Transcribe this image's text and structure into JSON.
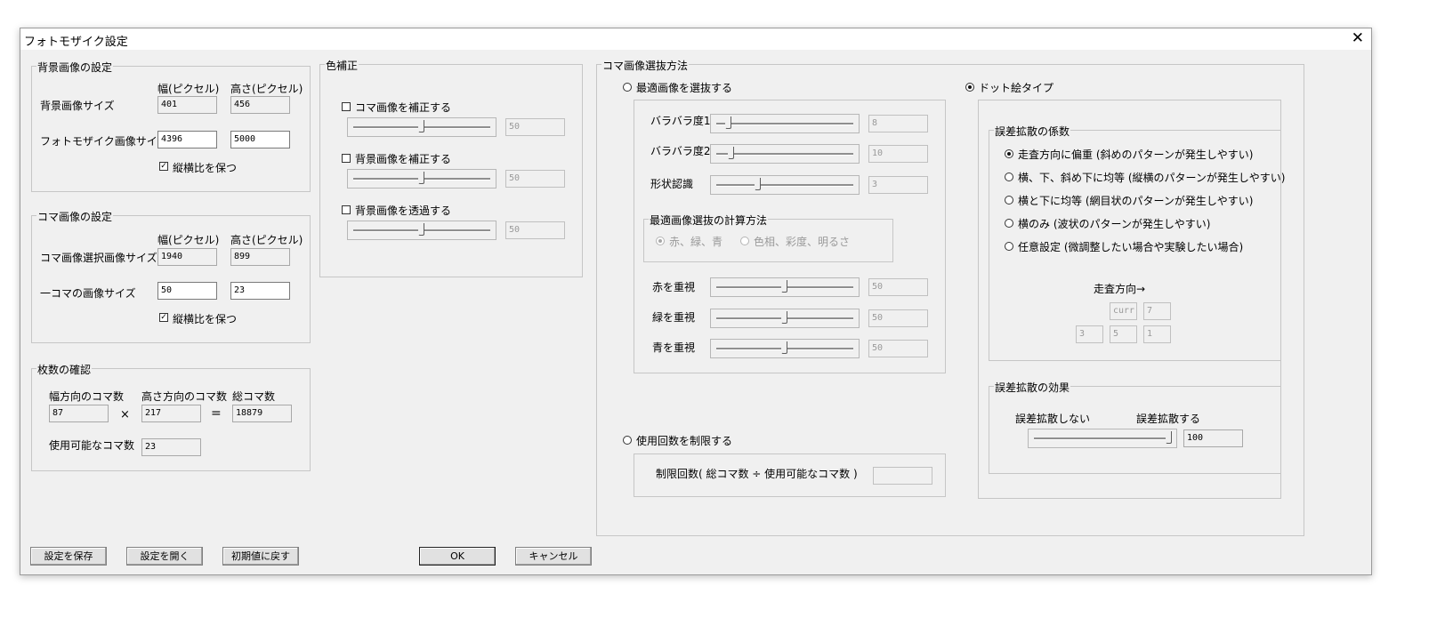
{
  "window": {
    "title": "フォトモザイク設定",
    "close_glyph": "✕"
  },
  "bg_settings": {
    "group_label": "背景画像の設定",
    "col_width": "幅(ピクセル)",
    "col_height": "高さ(ピクセル)",
    "bg_size_label": "背景画像サイズ",
    "bg_width": "401",
    "bg_height": "456",
    "mosaic_size_label": "フォトモザイク画像サイズ",
    "mosaic_width": "4396",
    "mosaic_height": "5000",
    "keep_ratio_label": "縦横比を保つ",
    "keep_ratio_checked": true
  },
  "tile_settings": {
    "group_label": "コマ画像の設定",
    "col_width": "幅(ピクセル)",
    "col_height": "高さ(ピクセル)",
    "select_size_label": "コマ画像選択画像サイズ",
    "select_width": "1940",
    "select_height": "899",
    "tile_size_label": "一コマの画像サイズ",
    "tile_width": "50",
    "tile_height": "23",
    "keep_ratio_label": "縦横比を保つ",
    "keep_ratio_checked": true
  },
  "count_check": {
    "group_label": "枚数の確認",
    "width_tiles_label": "幅方向のコマ数",
    "height_tiles_label": "高さ方向のコマ数",
    "total_tiles_label": "総コマ数",
    "width_tiles": "87",
    "times_sign": "×",
    "height_tiles": "217",
    "equals_sign": "=",
    "total_tiles": "18879",
    "usable_label": "使用可能なコマ数",
    "usable_tiles": "23"
  },
  "color_correction": {
    "group_label": "色補正",
    "items": [
      {
        "label": "コマ画像を補正する",
        "checked": false,
        "value": "50",
        "level": 0.5
      },
      {
        "label": "背景画像を補正する",
        "checked": false,
        "value": "50",
        "level": 0.5
      },
      {
        "label": "背景画像を透過する",
        "checked": false,
        "value": "50",
        "level": 0.5
      }
    ]
  },
  "tile_selection": {
    "group_label": "コマ画像選抜方法",
    "best_image_label": "最適画像を選抜する",
    "best_image_selected": false,
    "sliders": [
      {
        "label": "バラバラ度1",
        "value": "8",
        "level": 0.08
      },
      {
        "label": "バラバラ度2",
        "value": "10",
        "level": 0.1
      },
      {
        "label": "形状認識",
        "value": "3",
        "level": 0.3
      }
    ],
    "calc_method": {
      "group_label": "最適画像選抜の計算方法",
      "rgb_label": "赤、緑、青",
      "rgb_selected": true,
      "hsv_label": "色相、彩度、明るさ",
      "hsv_selected": false
    },
    "weights": [
      {
        "label": "赤を重視",
        "value": "50",
        "level": 0.5
      },
      {
        "label": "緑を重視",
        "value": "50",
        "level": 0.5
      },
      {
        "label": "青を重視",
        "value": "50",
        "level": 0.5
      }
    ],
    "dot_type_label": "ドット絵タイプ",
    "dot_type_selected": true,
    "limit_label": "使用回数を制限する",
    "limit_selected": false,
    "limit_count_label": "制限回数( 総コマ数 ÷ 使用可能なコマ数 )",
    "limit_count_value": ""
  },
  "diffusion": {
    "coef_group_label": "誤差拡散の係数",
    "options": [
      {
        "label": "走査方向に偏重 (斜めのパターンが発生しやすい)",
        "selected": true
      },
      {
        "label": "横、下、斜め下に均等 (縦横のパターンが発生しやすい)",
        "selected": false
      },
      {
        "label": "横と下に均等 (網目状のパターンが発生しやすい)",
        "selected": false
      },
      {
        "label": "横のみ (波状のパターンが発生しやすい)",
        "selected": false
      },
      {
        "label": "任意設定 (微調整したい場合や実験したい場合)",
        "selected": false
      }
    ],
    "scan_direction_label": "走査方向→",
    "matrix": {
      "curr": "curr",
      "right": "7",
      "bottom_left": "3",
      "bottom": "5",
      "bottom_right": "1"
    },
    "effect_group_label": "誤差拡散の効果",
    "no_diffusion_label": "誤差拡散しない",
    "diffusion_label": "誤差拡散する",
    "effect_value": "100",
    "effect_level": 1.0
  },
  "buttons": {
    "save": "設定を保存",
    "open": "設定を開く",
    "reset": "初期値に戻す",
    "ok": "OK",
    "cancel": "キャンセル"
  }
}
